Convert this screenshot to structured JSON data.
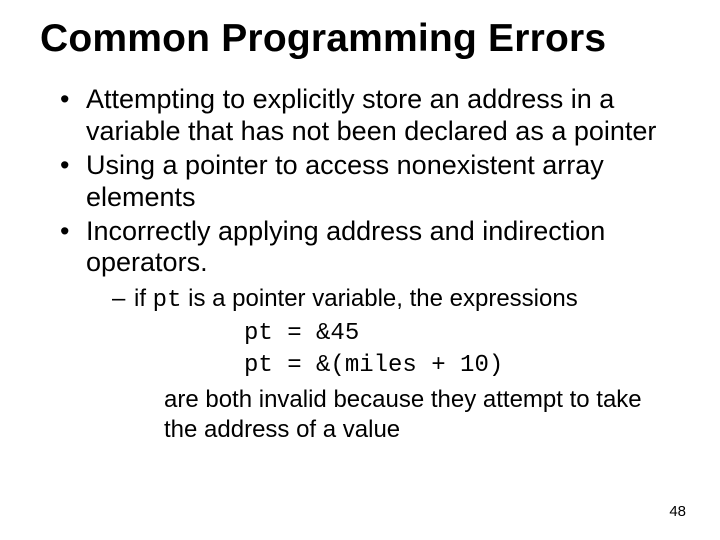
{
  "title": "Common Programming Errors",
  "bullets": {
    "b1": "Attempting to explicitly store an address in a variable that has not been declared as a pointer",
    "b2": "Using a pointer to access nonexistent array elements",
    "b3": "Incorrectly applying address and indirection operators."
  },
  "sub": {
    "lead_a": "if ",
    "pt": "pt",
    "lead_b": " is a pointer variable, the expressions",
    "code1": "pt = &45",
    "code2": "pt = &(miles + 10)",
    "tail": "are both invalid because they attempt to take the address of a value"
  },
  "page_number": "48"
}
